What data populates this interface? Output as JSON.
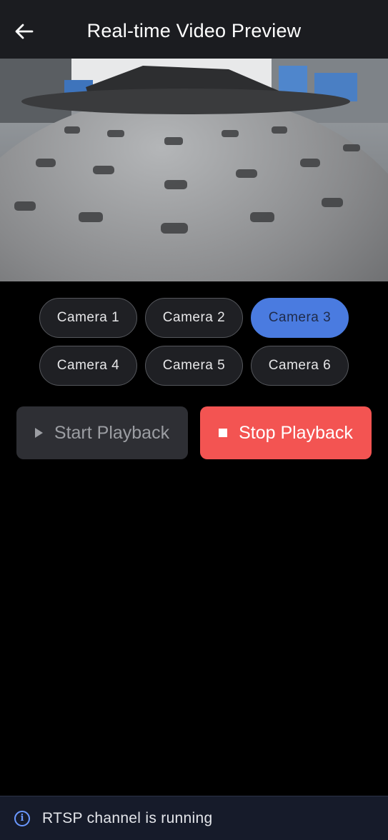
{
  "appbar": {
    "title": "Real-time Video Preview",
    "back_icon": "arrow-left-icon"
  },
  "video": {
    "description_icon": "video-frame"
  },
  "cameras": [
    {
      "label": "Camera 1",
      "active": false
    },
    {
      "label": "Camera 2",
      "active": false
    },
    {
      "label": "Camera 3",
      "active": true
    },
    {
      "label": "Camera 4",
      "active": false
    },
    {
      "label": "Camera 5",
      "active": false
    },
    {
      "label": "Camera 6",
      "active": false
    }
  ],
  "playback": {
    "start_label": "Start Playback",
    "stop_label": "Stop Playback"
  },
  "status": {
    "text": "RTSP channel is running",
    "icon": "info-icon"
  },
  "colors": {
    "accent": "#4a7be0",
    "stop": "#f35452",
    "appbar": "#1b1c20"
  }
}
